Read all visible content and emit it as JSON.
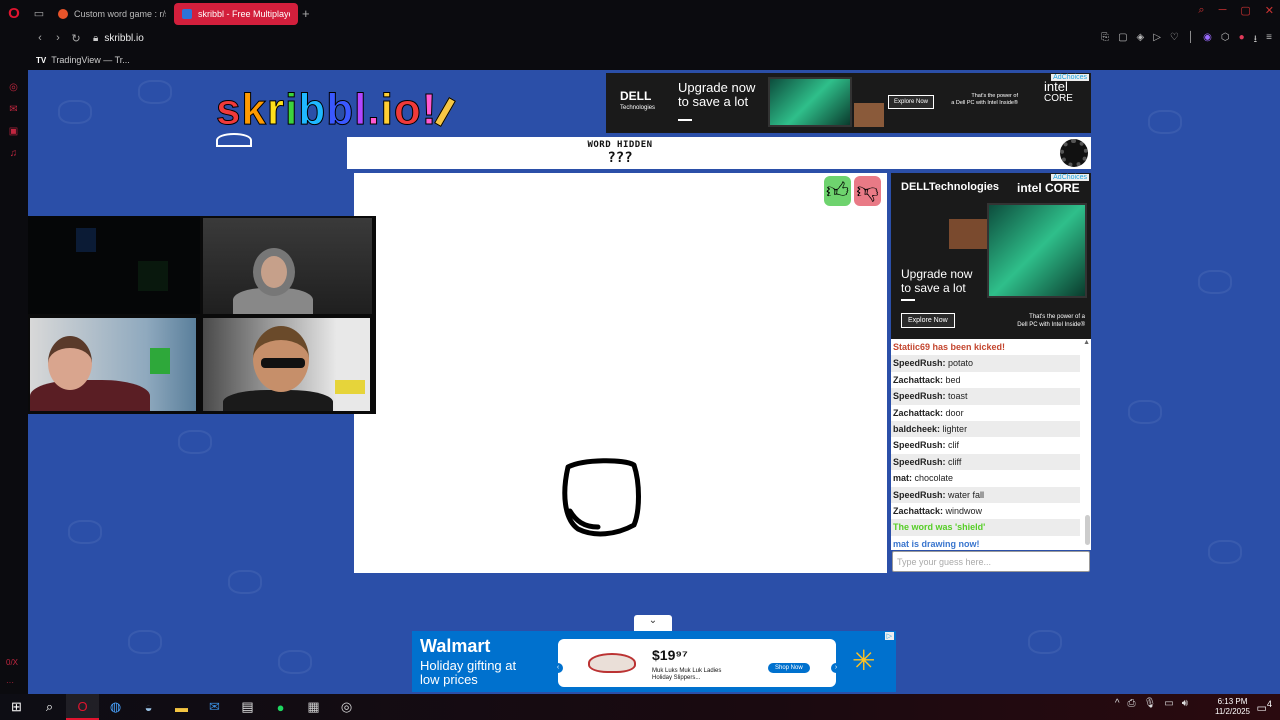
{
  "browser": {
    "tabs": [
      {
        "label": "Custom word game : r/skr",
        "active": false
      },
      {
        "label": "skribbl - Free Multiplayer",
        "active": true
      }
    ],
    "new_tab_icon": "+",
    "url": "skribbl.io",
    "bookmarks": [
      {
        "label": "TradingView — Tr..."
      }
    ],
    "bookmark_icon_label": "TV",
    "sidebar_bottom_label": "0/X"
  },
  "game": {
    "logo_text": "skribbl.io",
    "word_label": "WORD HIDDEN",
    "word_value": "???",
    "guess_placeholder": "Type your guess here...",
    "chat": [
      {
        "type": "system-kick",
        "text": "Statiic69 has been kicked!"
      },
      {
        "type": "guess",
        "user": "SpeedRush:",
        "text": "potato"
      },
      {
        "type": "guess",
        "user": "Zachattack:",
        "text": "bed"
      },
      {
        "type": "guess",
        "user": "SpeedRush:",
        "text": "toast"
      },
      {
        "type": "guess",
        "user": "Zachattack:",
        "text": "door"
      },
      {
        "type": "guess",
        "user": "baldcheek:",
        "text": "lighter"
      },
      {
        "type": "guess",
        "user": "SpeedRush:",
        "text": "clif"
      },
      {
        "type": "guess",
        "user": "SpeedRush:",
        "text": "cliff"
      },
      {
        "type": "guess",
        "user": "mat:",
        "text": "chocolate"
      },
      {
        "type": "guess",
        "user": "SpeedRush:",
        "text": "water fall"
      },
      {
        "type": "guess",
        "user": "Zachattack:",
        "text": "windwow"
      },
      {
        "type": "system-word",
        "text": "The word was 'shield'"
      },
      {
        "type": "system-draw",
        "text": "mat is drawing now!"
      }
    ]
  },
  "ads": {
    "top": {
      "brand": "DELL",
      "brand_sub": "Technologies",
      "headline_1": "Upgrade now",
      "headline_2": "to save a lot",
      "cta": "Explore Now",
      "power_1": "That's the power of",
      "power_2": "a Dell PC with Intel Inside®",
      "intel_1": "intel",
      "intel_2": "CORE",
      "adchoices": "AdChoices"
    },
    "side": {
      "brand": "DELLTechnologies",
      "intel": "intel CORE",
      "headline_1": "Upgrade now",
      "headline_2": "to save a lot",
      "cta": "Explore Now",
      "power_1": "That's the power of a",
      "power_2": "Dell PC with Intel Inside®",
      "adchoices": "AdChoices"
    },
    "bottom": {
      "brand": "Walmart",
      "tag_1": "Holiday gifting at",
      "tag_2": "low prices",
      "price": "$19⁹⁷",
      "product_1": "Muk Luks Muk Luk Ladies",
      "product_2": "Holiday Slippers...",
      "cta": "Shop Now",
      "adchoices": "▷"
    }
  },
  "taskbar": {
    "time": "6:13 PM",
    "date": "11/2/2025",
    "notifications": "4"
  },
  "colors": {
    "page_bg": "#2b4fa8",
    "opera_red": "#e0142f",
    "kick_text": "#c4462f",
    "word_text": "#56ce27",
    "draw_text": "#3975ce"
  }
}
